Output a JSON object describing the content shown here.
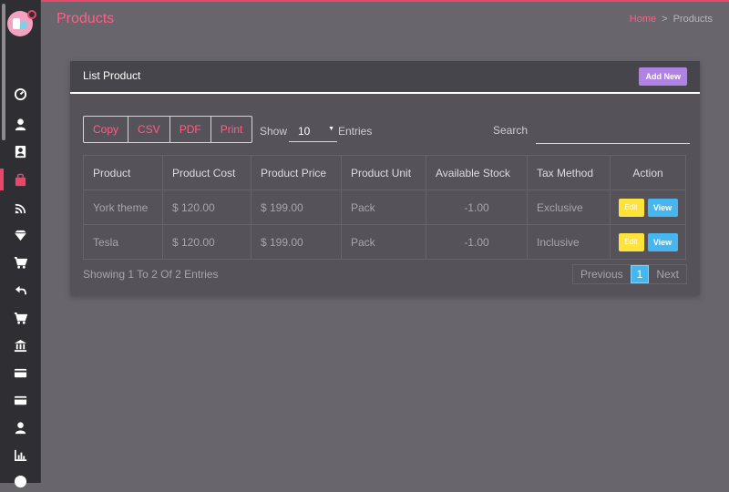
{
  "header": {
    "title": "Products"
  },
  "breadcrumb": {
    "home": "Home",
    "separator": ">",
    "current": "Products"
  },
  "card": {
    "title": "List Product",
    "add_button": "Add New"
  },
  "export_buttons": [
    "Copy",
    "CSV",
    "PDF",
    "Print"
  ],
  "controls": {
    "show_label": "Show",
    "page_size": "10",
    "entries_label": "Entries",
    "search_label": "Search"
  },
  "table": {
    "columns": [
      "Product",
      "Product Cost",
      "Product Price",
      "Product Unit",
      "Available Stock",
      "Tax Method",
      "Action"
    ],
    "rows": [
      [
        "York theme",
        "$ 120.00",
        "$ 199.00",
        "Pack",
        "-1.00",
        "Exclusive"
      ],
      [
        "Tesla",
        "$ 120.00",
        "$ 199.00",
        "Pack",
        "-1.00",
        "Inclusive"
      ]
    ],
    "edit_label": "Edit",
    "view_label": "View"
  },
  "footer": {
    "showing": "Showing 1 To 2 Of 2 Entries",
    "previous": "Previous",
    "page": "1",
    "next": "Next"
  },
  "sidebar_icons": [
    "dashboard-icon",
    "user-icon",
    "contacts-icon",
    "bag-icon",
    "cast-icon",
    "diamond-icon",
    "cart-icon",
    "return-icon",
    "cart-add-icon",
    "bank-icon",
    "card-icon",
    "card-icon",
    "user-group-icon",
    "report-icon",
    "help-icon"
  ],
  "colors": {
    "accent": "#ff5f82",
    "purple": "#b182e6",
    "edit": "#ffe23a",
    "view": "#45b6ef"
  }
}
